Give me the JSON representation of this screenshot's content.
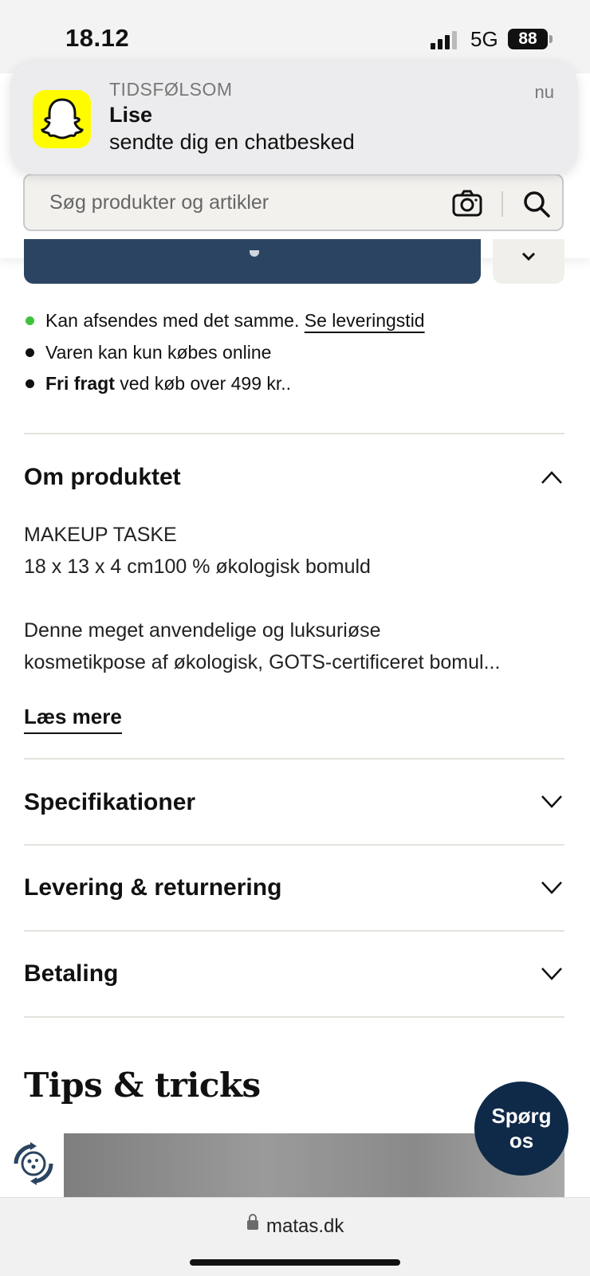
{
  "status": {
    "time": "18.12",
    "network": "5G",
    "battery": "88"
  },
  "notification": {
    "app": "TIDSFØLSOM",
    "time": "nu",
    "title": "Lise",
    "body": "sendte dig en chatbesked",
    "icon": "snapchat-ghost-icon",
    "icon_color": "#FFFC00"
  },
  "search": {
    "placeholder": "Søg produkter og artikler"
  },
  "colors": {
    "primary": "#2B4461",
    "in_stock": "#3FC33F",
    "ask_bubble": "#0F2A48"
  },
  "availability": {
    "stock_text": "Kan afsendes med det samme.",
    "delivery_link": "Se leveringstid",
    "online_only": "Varen kan kun købes online",
    "free_shipping_bold": "Fri fragt",
    "free_shipping_rest": "ved køb over 499 kr.."
  },
  "about": {
    "title": "Om produktet",
    "line1": "MAKEUP TASKE",
    "line2": "18 x 13 x 4 cm100 % økologisk bomuld",
    "line3": "Denne meget anvendelige og luksuriøse",
    "line4": "kosmetikpose af økologisk, GOTS-certificeret bomul...",
    "read_more": "Læs mere"
  },
  "accordions": {
    "specs": "Specifikationer",
    "delivery": "Levering & returnering",
    "payment": "Betaling"
  },
  "tips": {
    "title": "Tips & tricks"
  },
  "ask": {
    "line1": "Spørg",
    "line2": "os"
  },
  "browser": {
    "url": "matas.dk"
  }
}
